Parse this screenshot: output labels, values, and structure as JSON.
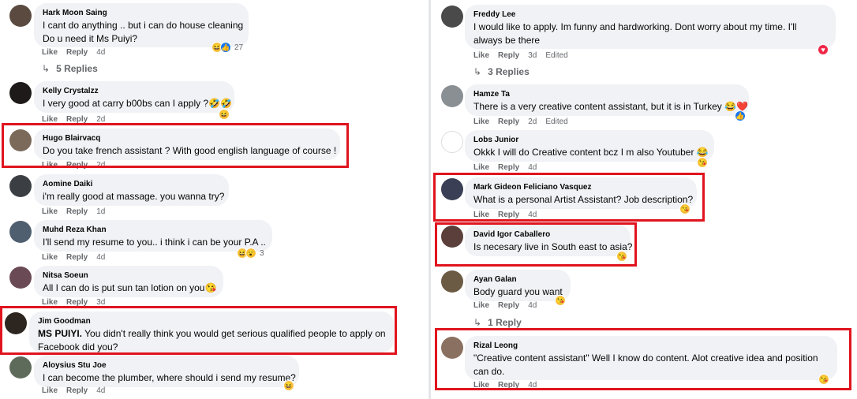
{
  "left": {
    "comments": [
      {
        "name": "Hark Moon Saing",
        "text": [
          "I cant do anything .. but i can do house cleaning",
          "Do u need it Ms Puiyi?"
        ],
        "like": "Like",
        "reply": "Reply",
        "time": "4d",
        "reactions": "27"
      },
      {
        "name": "Kelly Crystalzz",
        "text": [
          "I very good at carry b00bs can I apply ?🤣🤣"
        ],
        "like": "Like",
        "reply": "Reply",
        "time": "2d"
      },
      {
        "name": "Hugo Blairvacq",
        "text": [
          "Do you take french assistant ? With good english language of course !"
        ],
        "like": "Like",
        "reply": "Reply",
        "time": "2d"
      },
      {
        "name": "Aomine Daiki",
        "text": [
          "i'm really good at massage. you wanna try?"
        ],
        "like": "Like",
        "reply": "Reply",
        "time": "1d"
      },
      {
        "name": "Muhd Reza Khan",
        "text": [
          "I'll send my resume to you.. i think i can be your P.A .."
        ],
        "like": "Like",
        "reply": "Reply",
        "time": "4d",
        "reactions": "3"
      },
      {
        "name": "Nitsa Soeun",
        "text": [
          "All I can do is put sun tan lotion on you😘"
        ],
        "like": "Like",
        "reply": "Reply",
        "time": "3d"
      },
      {
        "name": "Jim Goodman",
        "text_bold": "MS PUIYI.",
        "text": [
          " You didn't really think you would get serious qualified people to apply on",
          "Facebook did you?"
        ]
      },
      {
        "name": "Aloysius Stu Joe",
        "text": [
          "I can become the plumber, where should i send my resume?"
        ],
        "like": "Like",
        "reply": "Reply",
        "time": "4d"
      }
    ],
    "replies_label": "5 Replies"
  },
  "right": {
    "comments": [
      {
        "name": "Freddy Lee",
        "text": [
          "I would like to apply. Im funny and hardworking. Dont worry about my time. I'll",
          "always be there"
        ],
        "like": "Like",
        "reply": "Reply",
        "time": "3d",
        "edited": "Edited"
      },
      {
        "name": "Hamze Ta",
        "text": [
          "There is a very creative content assistant, but it is in Turkey 😂❤️"
        ],
        "like": "Like",
        "reply": "Reply",
        "time": "2d",
        "edited": "Edited"
      },
      {
        "name": "Lobs Junior",
        "text": [
          "Okkk I will do Creative content bcz I m also Youtuber 😂"
        ],
        "like": "Like",
        "reply": "Reply",
        "time": "4d"
      },
      {
        "name": "Mark Gideon Feliciano Vasquez",
        "text": [
          "What is a personal Artist Assistant? Job description?"
        ],
        "like": "Like",
        "reply": "Reply",
        "time": "4d"
      },
      {
        "name": "David Igor Caballero",
        "text": [
          "Is necesary live in South east to asia?"
        ],
        "like": "Like",
        "reply": "Reply",
        "time": "4d"
      },
      {
        "name": "Ayan Galan",
        "text": [
          "Body guard you want"
        ],
        "like": "Like",
        "reply": "Reply",
        "time": "4d"
      },
      {
        "name": "Rizal Leong",
        "text": [
          "\"Creative content assistant\" Well I know do content. Alot creative idea and position",
          "can do."
        ],
        "like": "Like",
        "reply": "Reply",
        "time": "4d"
      }
    ],
    "replies_label_1": "3 Replies",
    "replies_label_2": "1 Reply"
  },
  "colors": {
    "highlight": "#e0141e",
    "bubble": "#f0f2f5",
    "meta": "#65676b"
  },
  "icons": [
    "haha-emoji",
    "like-reaction",
    "love-reaction",
    "care-emoji",
    "reply-arrow-icon"
  ]
}
